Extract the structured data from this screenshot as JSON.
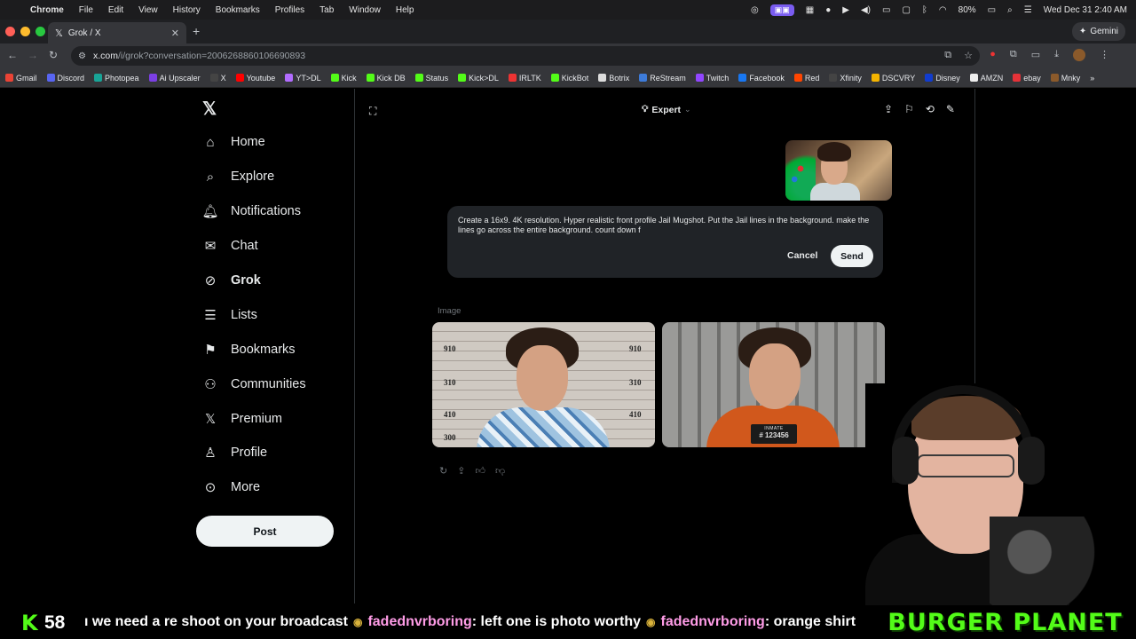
{
  "menubar": {
    "items": [
      "Chrome",
      "File",
      "Edit",
      "View",
      "History",
      "Bookmarks",
      "Profiles",
      "Tab",
      "Window",
      "Help"
    ],
    "battery": "80%",
    "datetime": "Wed Dec 31  2:40 AM"
  },
  "browser": {
    "tab_title": "Grok / X",
    "url_host": "x.com",
    "url_path": "/i/grok?conversation=2006268860106690893",
    "gemini_label": "Gemini",
    "bookmarks": [
      "Gmail",
      "Discord",
      "Photopea",
      "Ai Upscaler",
      "X",
      "Youtube",
      "YT>DL",
      "Kick",
      "Kick DB",
      "Status",
      "Kick>DL",
      "IRLTK",
      "KickBot",
      "Botrix",
      "ReStream",
      "Twitch",
      "Facebook",
      "Red",
      "Xfinity",
      "DSCVRY",
      "Disney",
      "AMZN",
      "ebay",
      "Mnky"
    ]
  },
  "sidebar": {
    "items": [
      {
        "label": "Home",
        "icon": "home-icon"
      },
      {
        "label": "Explore",
        "icon": "search-icon"
      },
      {
        "label": "Notifications",
        "icon": "bell-icon"
      },
      {
        "label": "Chat",
        "icon": "mail-icon"
      },
      {
        "label": "Grok",
        "icon": "grok-icon"
      },
      {
        "label": "Lists",
        "icon": "list-icon"
      },
      {
        "label": "Bookmarks",
        "icon": "bookmark-icon"
      },
      {
        "label": "Communities",
        "icon": "communities-icon"
      },
      {
        "label": "Premium",
        "icon": "x-logo-icon"
      },
      {
        "label": "Profile",
        "icon": "person-icon"
      },
      {
        "label": "More",
        "icon": "more-icon"
      }
    ],
    "post_label": "Post"
  },
  "grok": {
    "mode": "Expert",
    "prompt": "Create a 16x9. 4K resolution. Hyper realistic front profile Jail Mugshot. Put the Jail lines in the background. make the lines go across the entire background. count down f",
    "cancel_label": "Cancel",
    "send_label": "Send",
    "image_label": "Image",
    "image1_heights": [
      "910",
      "310",
      "410",
      "300"
    ],
    "image1_heights_right": [
      "910",
      "310",
      "410"
    ],
    "placard_title": "INMATE",
    "placard_number": "# 123456"
  },
  "stream": {
    "viewers": "58",
    "chat_text_1": "ı we need a re shoot on your broadcast",
    "chat_user_1": "fadednvrboring",
    "chat_text_2": ": left one is photo worthy",
    "chat_user_2": "fadednvrboring",
    "chat_text_3": ": orange shirt",
    "brand": "BURGER PLANET"
  },
  "colors": {
    "kick_green": "#53fc18",
    "x_bg": "#000000",
    "chat_user": "#ff9ce7"
  }
}
